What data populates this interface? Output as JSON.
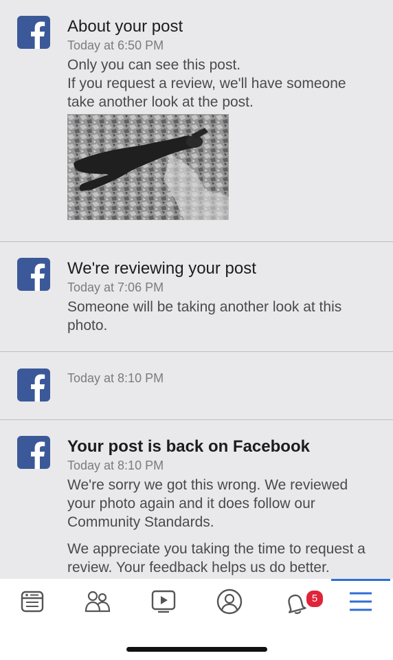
{
  "notifications": [
    {
      "title": "About your post",
      "time": "Today at 6:50 PM",
      "body": [
        "Only you can see this post.",
        "If you request a review, we'll have someone take another look at the post."
      ],
      "has_photo": true
    },
    {
      "title": "We're reviewing your post",
      "time": "Today at 7:06 PM",
      "body": [
        "Someone will be taking another look at this photo."
      ]
    },
    {
      "title": "",
      "time": "Today at 8:10 PM",
      "body": []
    },
    {
      "title": "Your post is back on Facebook",
      "time": "Today at 8:10 PM",
      "body": [
        "We're sorry we got this wrong. We reviewed your photo again and it does follow our Community Standards.",
        "We appreciate you taking the time to request a review. Your feedback helps us do better."
      ]
    }
  ],
  "tabbar": {
    "tabs": [
      {
        "icon": "news-feed-icon"
      },
      {
        "icon": "friends-icon"
      },
      {
        "icon": "watch-icon"
      },
      {
        "icon": "profile-icon"
      },
      {
        "icon": "notifications-bell-icon",
        "badge": "5"
      },
      {
        "icon": "menu-icon",
        "active": true
      }
    ]
  },
  "colors": {
    "facebook_blue": "#3b5998",
    "active_tab": "#2d6fd6",
    "badge_red": "#e0243a",
    "background": "#e9e9eb"
  }
}
